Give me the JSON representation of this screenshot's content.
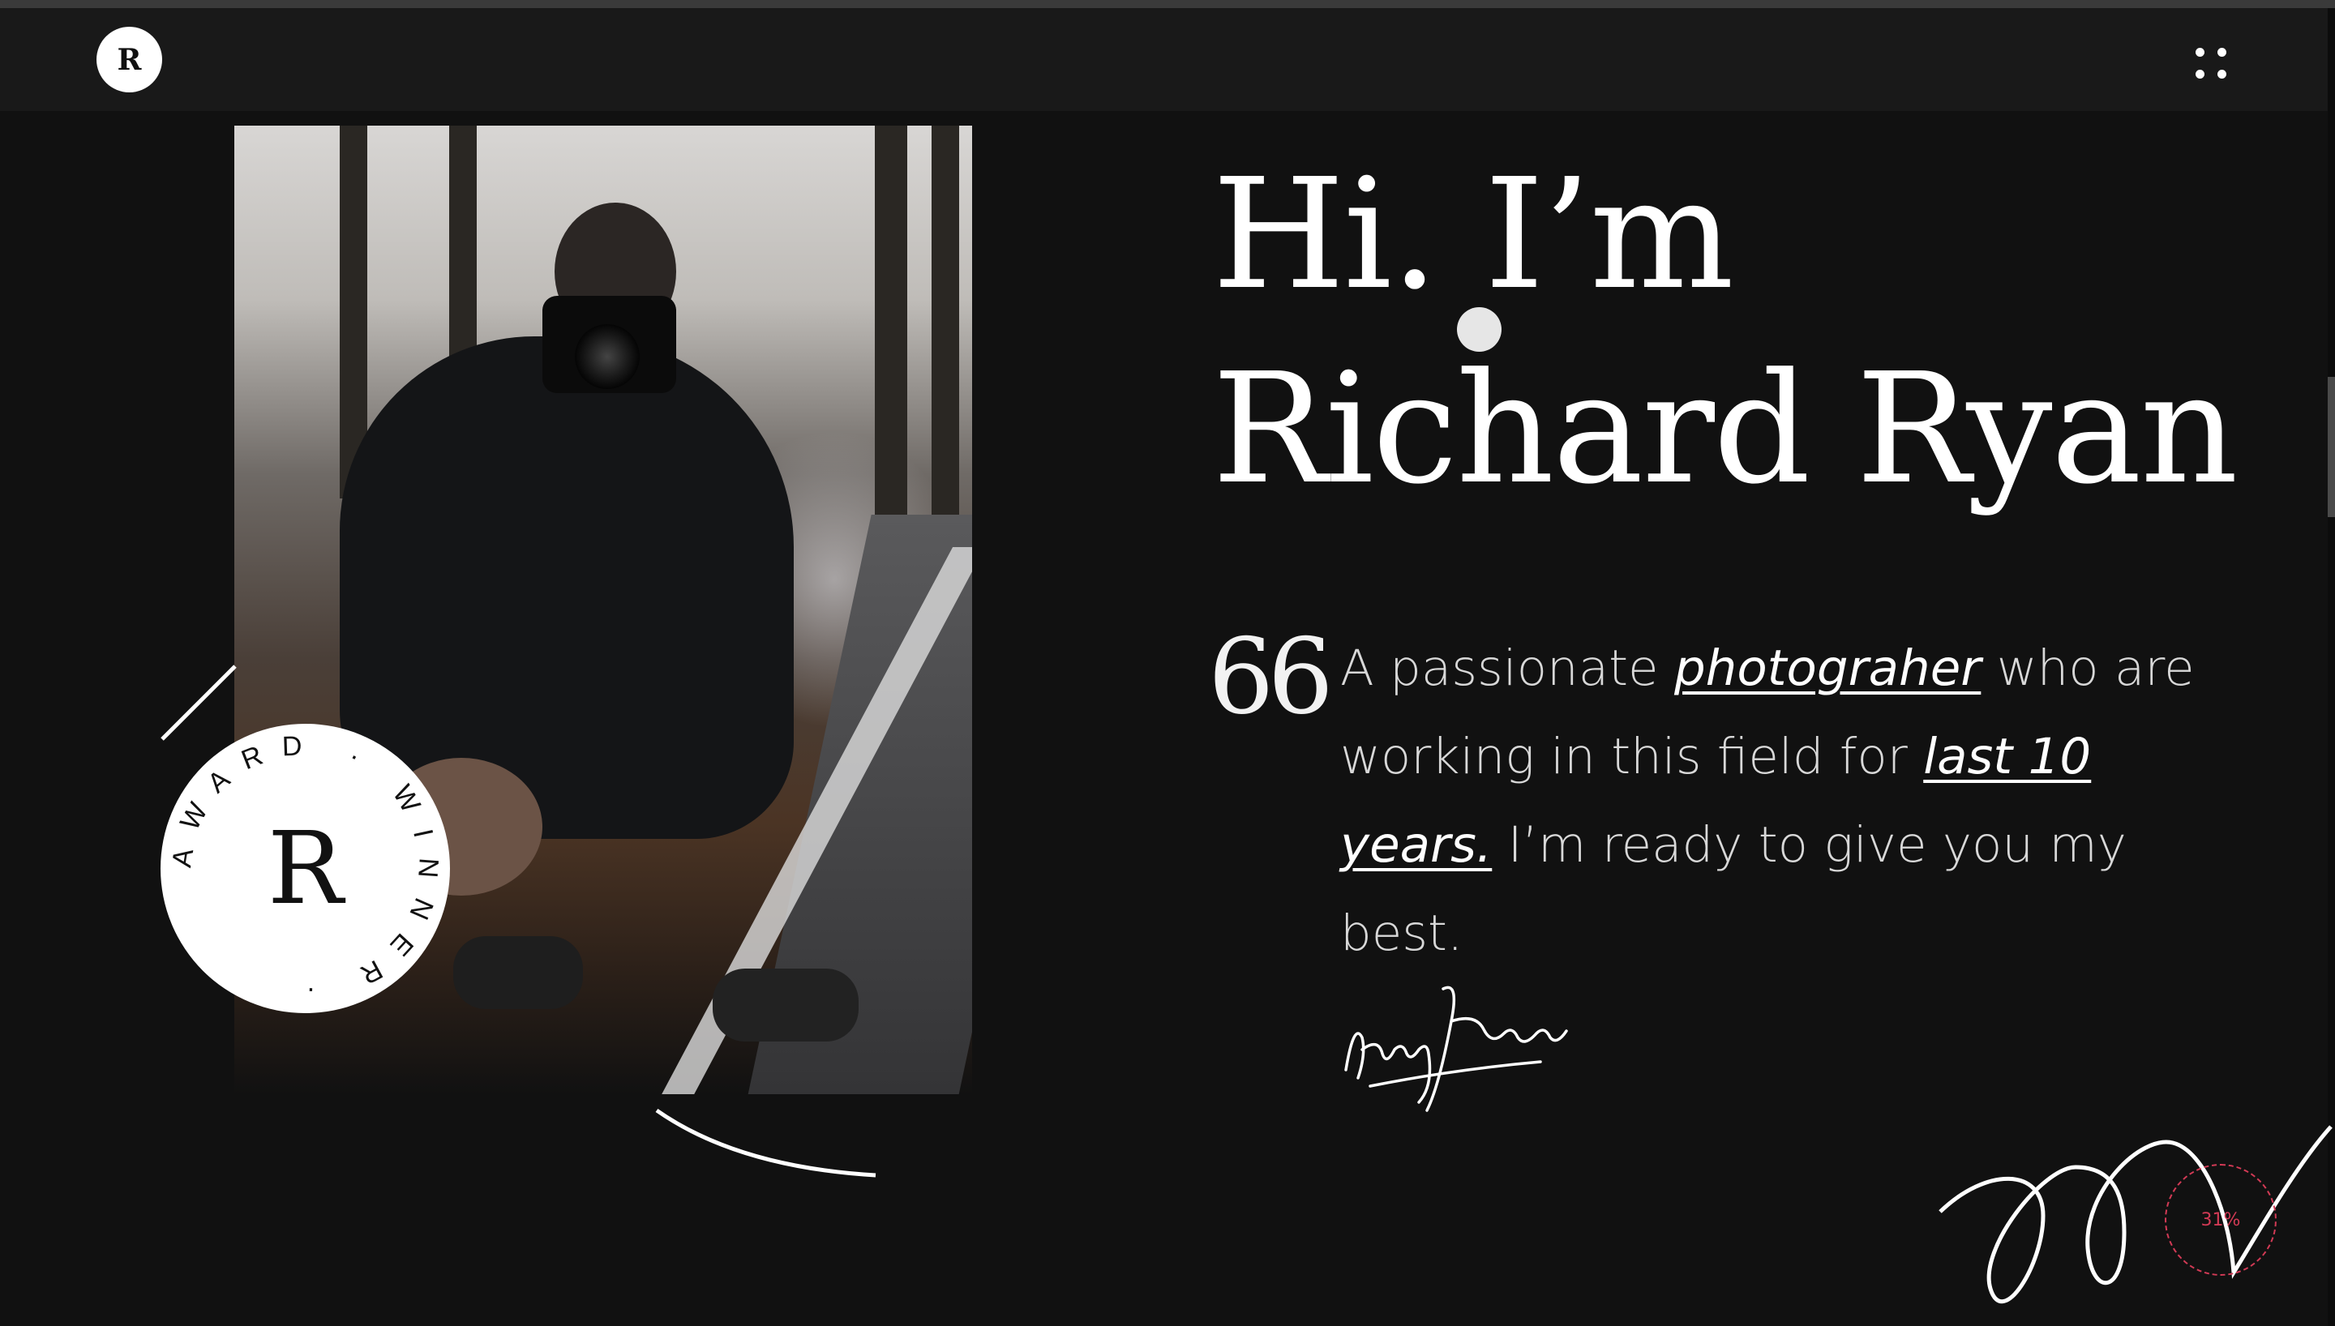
{
  "header": {
    "logo_letter": "R",
    "menu_icon": "grid-dots-icon"
  },
  "hero": {
    "title_line1": "Hi. I’m",
    "title_line2": "Richard Ryan",
    "photo_alt": "Photographer holding a camera"
  },
  "badge": {
    "ring_text": "AWARD · WINNER · ",
    "center_letter": "R"
  },
  "intro": {
    "quote_mark": "66",
    "part1": "A passionate ",
    "link1": "photograher",
    "part2": " who are working in this field for ",
    "link2": "last 10 years.",
    "part3": " I’m ready to give you my best."
  },
  "signature": {
    "text": "Henry James"
  },
  "scroll_progress": {
    "label": "31%",
    "value": 0.31
  },
  "colors": {
    "background": "#111111",
    "header": "#191919",
    "text": "#ffffff",
    "progress_accent": "#d23a55"
  }
}
